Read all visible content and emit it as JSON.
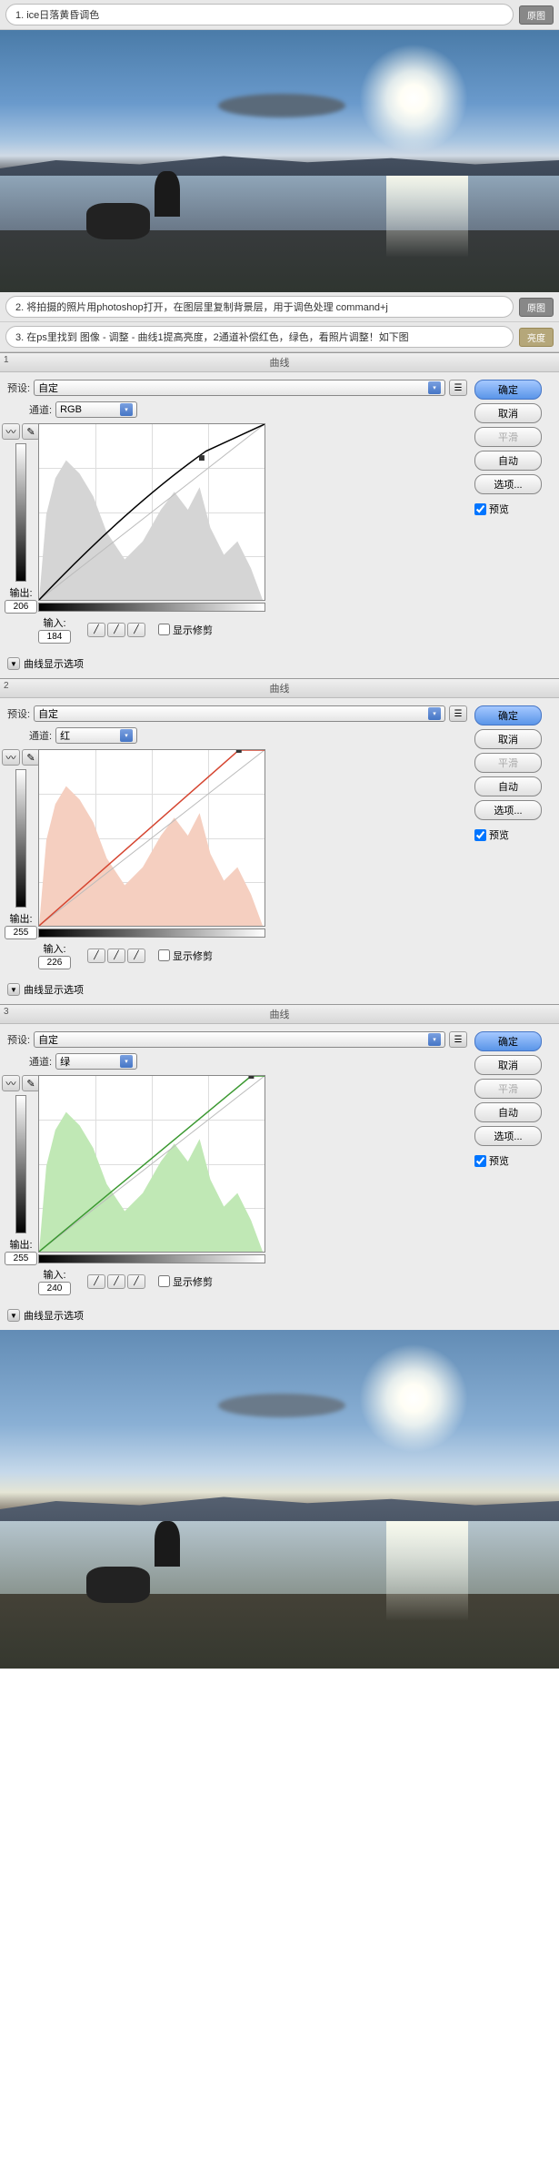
{
  "steps": {
    "s1": {
      "text": "1. ice日落黄昏调色",
      "tag": "原图"
    },
    "s2": {
      "text": "2. 将拍摄的照片用photoshop打开，在图层里复制背景层，用于调色处理 command+j",
      "tag": "原图"
    },
    "s3": {
      "text": "3. 在ps里找到 图像 - 调整 - 曲线1提高亮度，2通道补偿红色，绿色，看照片调整！如下图",
      "tag": "亮度"
    }
  },
  "labels": {
    "curves": "曲线",
    "preset": "预设:",
    "channel": "通道:",
    "output": "输出:",
    "input": "输入:",
    "show_clip": "显示修剪",
    "disclosure": "曲线显示选项",
    "custom": "自定"
  },
  "buttons": {
    "ok": "确定",
    "cancel": "取消",
    "smooth": "平滑",
    "auto": "自动",
    "options": "选项...",
    "preview": "预览"
  },
  "channels": {
    "rgb": "RGB",
    "red": "红",
    "green": "绿"
  },
  "panels": [
    {
      "num": "1",
      "channel": "RGB",
      "output": "206",
      "input": "184",
      "hist_color": "#d5d5d5",
      "curve_color": "#000"
    },
    {
      "num": "2",
      "channel": "红",
      "output": "255",
      "input": "226",
      "hist_color": "#f5cfc0",
      "curve_color": "#d54530"
    },
    {
      "num": "3",
      "channel": "绿",
      "output": "255",
      "input": "240",
      "hist_color": "#c0e8b5",
      "curve_color": "#3a9830"
    }
  ]
}
